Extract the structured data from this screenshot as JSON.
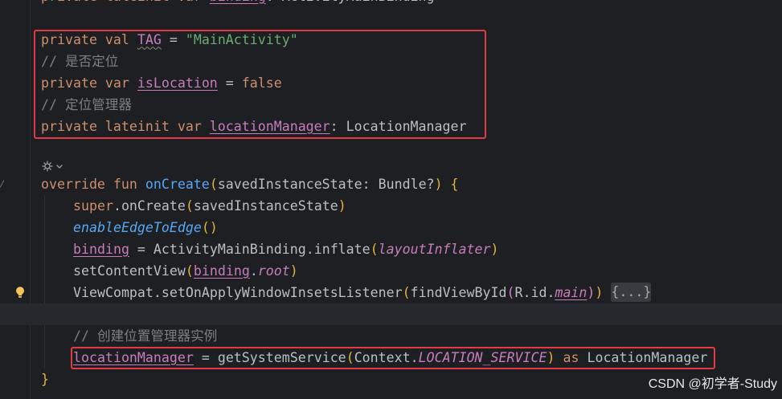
{
  "editor": {
    "lines": [
      [
        "private lateinit var ",
        "binding",
        ": ActivityMainBinding"
      ],
      [],
      [
        "private val ",
        "TAG",
        " = ",
        "\"MainActivity\""
      ],
      [
        "// 是否定位"
      ],
      [
        "private var ",
        "isLocation",
        " = ",
        "false"
      ],
      [
        "// 定位管理器"
      ],
      [
        "private lateinit var ",
        "locationManager",
        ": LocationManager"
      ],
      [],
      [
        "override fun ",
        "onCreate",
        "(",
        "savedInstanceState: Bundle?",
        ")",
        " {"
      ],
      [
        "super",
        ".onCreate",
        "(",
        "savedInstanceState",
        ")"
      ],
      [
        "enableEdgeToEdge",
        "()"
      ],
      [
        "binding",
        " = ActivityMainBinding.inflate",
        "(",
        "layoutInflater",
        ")"
      ],
      [
        "setContentView",
        "(",
        "binding",
        ".",
        "root",
        ")"
      ],
      [
        "ViewCompat.setOnApplyWindowInsetsListener",
        "(",
        "findViewById",
        "(",
        "R.id.",
        "main",
        ")",
        ")",
        "{...}"
      ],
      [],
      [
        "// 创建位置管理器实例"
      ],
      [
        "locationManager",
        " = getSystemService",
        "(",
        "Context.",
        "LOCATION_SERVICE",
        ")",
        " as",
        " LocationManager"
      ],
      [
        "}"
      ]
    ]
  },
  "watermark": "CSDN @初学者-Study",
  "icons": {
    "intention_action": "lightbulb-icon",
    "inlay_menu": "gear-icon",
    "inlay_dropdown": "chevron-down-icon"
  },
  "colors": {
    "bg": "#1e1f22",
    "plain": "#bcbec4",
    "keyword": "#cf8e6d",
    "string": "#6aab73",
    "comment": "#7a7e85",
    "property": "#c77dbb",
    "function": "#56a8f5",
    "bracket1": "#e2b340",
    "bracket2": "#d47fca",
    "warning": "#8e8c70",
    "current": "#26282e",
    "annotation": "#e23b43",
    "bulb": "#f2c55c",
    "fold_bg": "#393b40",
    "fold_text": "#a7a9ae",
    "icon": "#9a9da3",
    "watermark": "#e8e8e8"
  }
}
